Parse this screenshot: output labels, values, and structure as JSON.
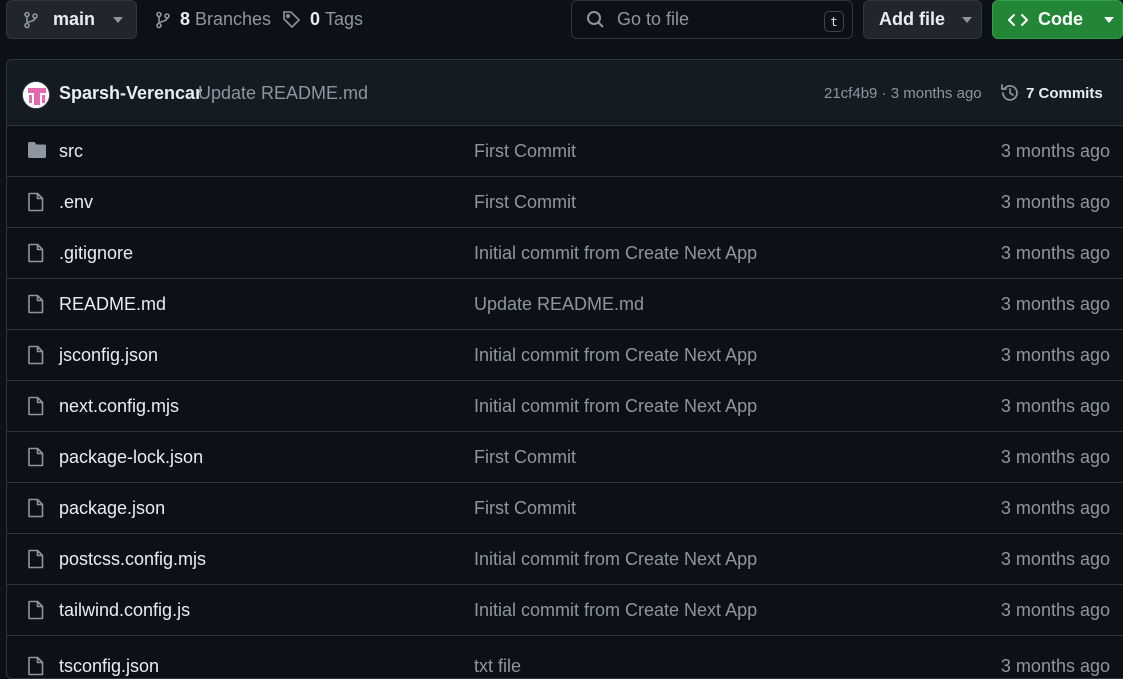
{
  "toolbar": {
    "branch_label": "main",
    "branches_count": "8",
    "branches_label": "Branches",
    "tags_count": "0",
    "tags_label": "Tags",
    "search_placeholder": "Go to file",
    "search_shortcut": "t",
    "add_file_label": "Add file",
    "code_label": "Code"
  },
  "latest_commit": {
    "author": "Sparsh-Verencar",
    "message": "Update README.md",
    "hash": "21cf4b9",
    "separator": " · ",
    "age": "3 months ago",
    "commits_count_label": "7 Commits"
  },
  "files": [
    {
      "type": "folder",
      "name": "src",
      "message": "First Commit",
      "age": "3 months ago"
    },
    {
      "type": "file",
      "name": ".env",
      "message": "First Commit",
      "age": "3 months ago"
    },
    {
      "type": "file",
      "name": ".gitignore",
      "message": "Initial commit from Create Next App",
      "age": "3 months ago"
    },
    {
      "type": "file",
      "name": "README.md",
      "message": "Update README.md",
      "age": "3 months ago"
    },
    {
      "type": "file",
      "name": "jsconfig.json",
      "message": "Initial commit from Create Next App",
      "age": "3 months ago"
    },
    {
      "type": "file",
      "name": "next.config.mjs",
      "message": "Initial commit from Create Next App",
      "age": "3 months ago"
    },
    {
      "type": "file",
      "name": "package-lock.json",
      "message": "First Commit",
      "age": "3 months ago"
    },
    {
      "type": "file",
      "name": "package.json",
      "message": "First Commit",
      "age": "3 months ago"
    },
    {
      "type": "file",
      "name": "postcss.config.mjs",
      "message": "Initial commit from Create Next App",
      "age": "3 months ago"
    },
    {
      "type": "file",
      "name": "tailwind.config.js",
      "message": "Initial commit from Create Next App",
      "age": "3 months ago"
    },
    {
      "type": "file",
      "name": "tsconfig.json",
      "message": "txt file",
      "age": "3 months ago"
    }
  ],
  "icons": {
    "branch": "git-branch-icon",
    "tag": "tag-icon",
    "search": "search-icon",
    "history": "history-icon",
    "folder": "folder-icon",
    "file": "file-icon",
    "code": "code-icon",
    "caret": "triangle-down-icon"
  },
  "colors": {
    "background": "#0d1117",
    "header_bg": "#151b23",
    "border": "#30363d",
    "text": "#e6edf3",
    "muted": "#8d96a0",
    "code_button": "#238636"
  }
}
